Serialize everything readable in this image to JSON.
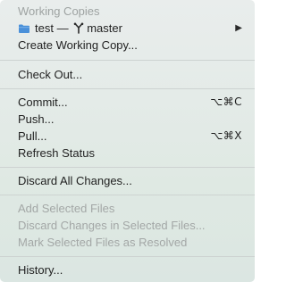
{
  "menu": {
    "section_header": "Working Copies",
    "repo": {
      "name": "test",
      "dash": "—",
      "branch": "master",
      "icon": "folder-icon",
      "branch_icon": "branch-icon",
      "submenu_indicator": "▶"
    },
    "create_working_copy": "Create Working Copy...",
    "check_out": "Check Out...",
    "commit": {
      "label": "Commit...",
      "shortcut": "⌥⌘C"
    },
    "push": "Push...",
    "pull": {
      "label": "Pull...",
      "shortcut": "⌥⌘X"
    },
    "refresh_status": "Refresh Status",
    "discard_all": "Discard All Changes...",
    "add_selected": "Add Selected Files",
    "discard_selected": "Discard Changes in Selected Files...",
    "mark_resolved": "Mark Selected Files as Resolved",
    "history": "History..."
  },
  "colors": {
    "folder_blue": "#4a90d9",
    "disabled_text": "#a3a7a6",
    "separator": "#cdd3d1"
  }
}
